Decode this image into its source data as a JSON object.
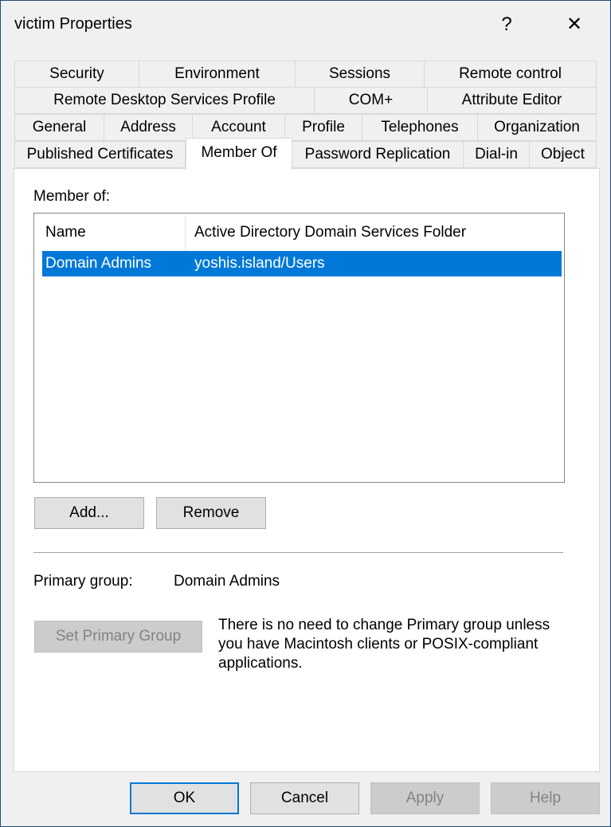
{
  "window": {
    "title": "victim Properties",
    "help_label": "?",
    "close_label": "✕"
  },
  "tabs": {
    "row1": [
      "Security",
      "Environment",
      "Sessions",
      "Remote control"
    ],
    "row2": [
      "Remote Desktop Services Profile",
      "COM+",
      "Attribute Editor"
    ],
    "row3": [
      "General",
      "Address",
      "Account",
      "Profile",
      "Telephones",
      "Organization"
    ],
    "row4": [
      "Published Certificates",
      "Member Of",
      "Password Replication",
      "Dial-in",
      "Object"
    ],
    "selected": "Member Of"
  },
  "member_of": {
    "label": "Member of:",
    "columns": [
      "Name",
      "Active Directory Domain Services Folder"
    ],
    "rows": [
      {
        "name": "Domain Admins",
        "folder": "yoshis.island/Users",
        "selected": true
      }
    ],
    "add_label": "Add...",
    "remove_label": "Remove"
  },
  "primary_group": {
    "label": "Primary group:",
    "value": "Domain Admins",
    "set_label": "Set Primary Group",
    "info": [
      "There is no need to change Primary group unless",
      "you have Macintosh clients or POSIX-compliant",
      "applications."
    ]
  },
  "footer": {
    "ok": "OK",
    "cancel": "Cancel",
    "apply": "Apply",
    "help": "Help"
  },
  "colors": {
    "selection": "#0078d7",
    "border": "#1e4a6e"
  }
}
